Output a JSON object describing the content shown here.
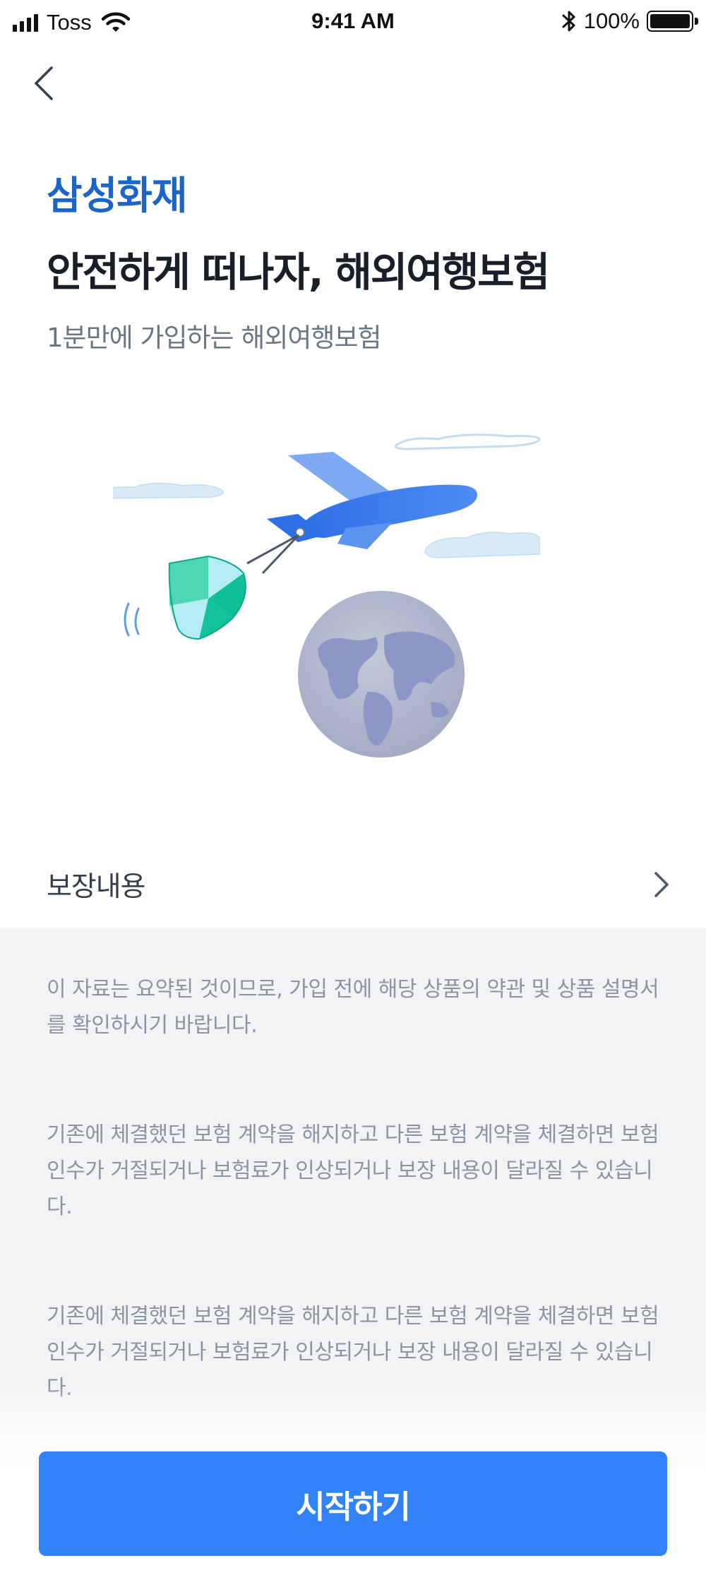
{
  "status_bar": {
    "carrier": "Toss",
    "time": "9:41 AM",
    "battery_percent": "100%",
    "icons": [
      "signal-icon",
      "wifi-icon",
      "bluetooth-icon",
      "battery-icon"
    ]
  },
  "header": {
    "back_icon": "chevron-left-icon"
  },
  "brand": "삼성화재",
  "headline": "안전하게 떠나자, 해외여행보험",
  "subtitle": "1분만에 가입하는 해외여행보험",
  "illustration": {
    "icon": "airplane-globe-illustration"
  },
  "coverage": {
    "label": "보장내용",
    "icon": "chevron-right-icon"
  },
  "notice": {
    "paragraph1": "이 자료는 요약된 것이므로, 가입 전에 해당 상품의 약관 및 상품 설명서를 확인하시기 바랍니다.",
    "paragraph2": "기존에 체결했던 보험 계약을 해지하고 다른 보험 계약을 체결하면 보험인수가 거절되거나 보험료가 인상되거나 보장 내용이 달라질 수 있습니다.",
    "paragraph3": "기존에 체결했던 보험 계약을 해지하고 다른 보험 계약을 체결하면 보험인수가 거절되거나 보험료가 인상되거나 보장 내용이 달라질 수 있습니다."
  },
  "cta": {
    "label": "시작하기"
  },
  "colors": {
    "brand": "#1b64c9",
    "primary": "#3182f6",
    "notice_bg": "#f2f3f5",
    "notice_text": "#8b95a1"
  }
}
